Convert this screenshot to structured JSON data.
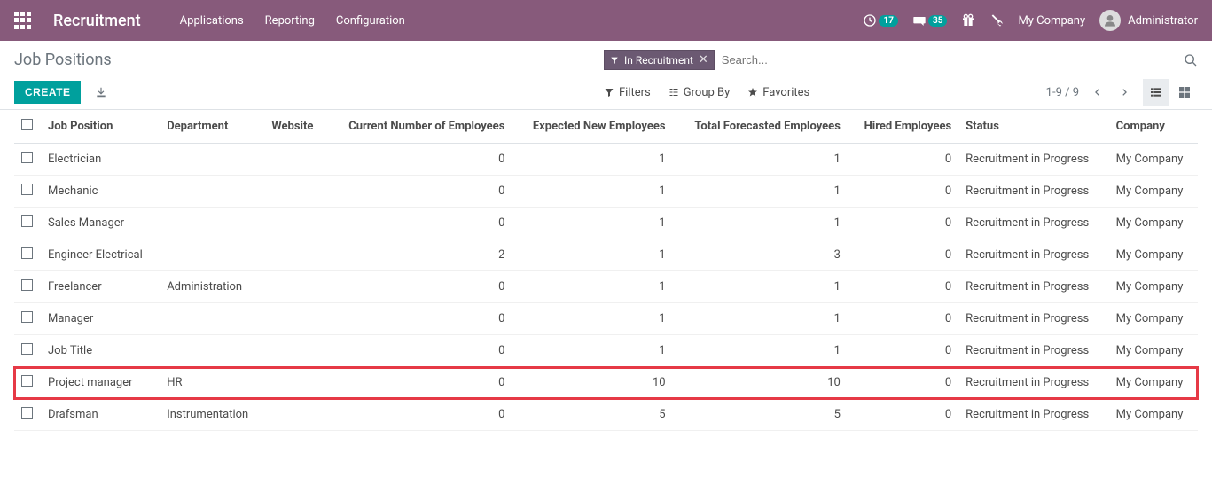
{
  "navbar": {
    "brand": "Recruitment",
    "menu": [
      "Applications",
      "Reporting",
      "Configuration"
    ],
    "activity_count": "17",
    "messages_count": "35",
    "company": "My Company",
    "user": "Administrator"
  },
  "page": {
    "title": "Job Positions",
    "create_label": "CREATE",
    "filter_tag": "In Recruitment",
    "search_placeholder": "Search...",
    "filters_label": "Filters",
    "groupby_label": "Group By",
    "favorites_label": "Favorites",
    "pager": "1-9 / 9"
  },
  "table": {
    "headers": {
      "position": "Job Position",
      "department": "Department",
      "website": "Website",
      "current": "Current Number of Employees",
      "expected": "Expected New Employees",
      "forecasted": "Total Forecasted Employees",
      "hired": "Hired Employees",
      "status": "Status",
      "company": "Company"
    },
    "rows": [
      {
        "position": "Electrician",
        "department": "",
        "website": "",
        "current": "0",
        "expected": "1",
        "forecasted": "1",
        "hired": "0",
        "status": "Recruitment in Progress",
        "company": "My Company",
        "highlight": false
      },
      {
        "position": "Mechanic",
        "department": "",
        "website": "",
        "current": "0",
        "expected": "1",
        "forecasted": "1",
        "hired": "0",
        "status": "Recruitment in Progress",
        "company": "My Company",
        "highlight": false
      },
      {
        "position": "Sales Manager",
        "department": "",
        "website": "",
        "current": "0",
        "expected": "1",
        "forecasted": "1",
        "hired": "0",
        "status": "Recruitment in Progress",
        "company": "My Company",
        "highlight": false
      },
      {
        "position": "Engineer Electrical",
        "department": "",
        "website": "",
        "current": "2",
        "expected": "1",
        "forecasted": "3",
        "hired": "0",
        "status": "Recruitment in Progress",
        "company": "My Company",
        "highlight": false
      },
      {
        "position": "Freelancer",
        "department": "Administration",
        "website": "",
        "current": "0",
        "expected": "1",
        "forecasted": "1",
        "hired": "0",
        "status": "Recruitment in Progress",
        "company": "My Company",
        "highlight": false
      },
      {
        "position": "Manager",
        "department": "",
        "website": "",
        "current": "0",
        "expected": "1",
        "forecasted": "1",
        "hired": "0",
        "status": "Recruitment in Progress",
        "company": "My Company",
        "highlight": false
      },
      {
        "position": "Job Title",
        "department": "",
        "website": "",
        "current": "0",
        "expected": "1",
        "forecasted": "1",
        "hired": "0",
        "status": "Recruitment in Progress",
        "company": "My Company",
        "highlight": false
      },
      {
        "position": "Project manager",
        "department": "HR",
        "website": "",
        "current": "0",
        "expected": "10",
        "forecasted": "10",
        "hired": "0",
        "status": "Recruitment in Progress",
        "company": "My Company",
        "highlight": true
      },
      {
        "position": "Drafsman",
        "department": "Instrumentation",
        "website": "",
        "current": "0",
        "expected": "5",
        "forecasted": "5",
        "hired": "0",
        "status": "Recruitment in Progress",
        "company": "My Company",
        "highlight": false
      }
    ]
  }
}
